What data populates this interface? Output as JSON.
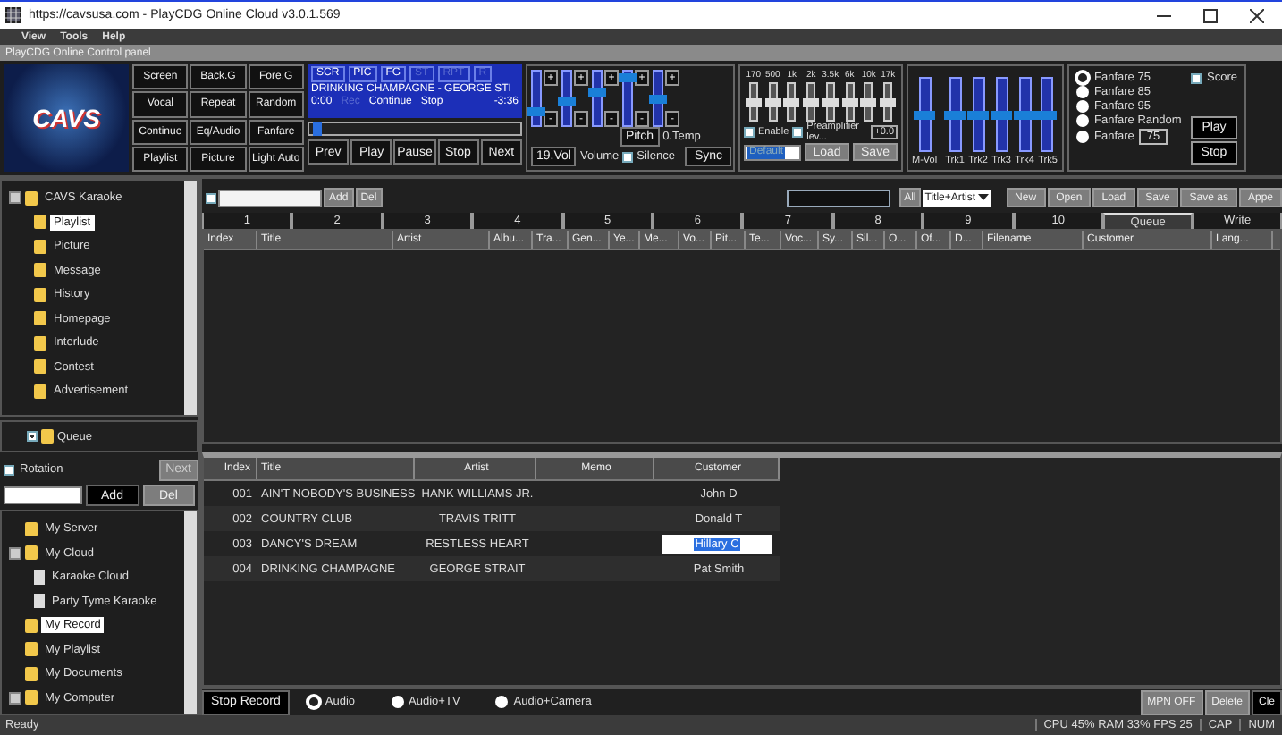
{
  "window": {
    "title": "https://cavsusa.com - PlayCDG Online Cloud v3.0.1.569"
  },
  "menu": [
    "View",
    "Tools",
    "Help"
  ],
  "panel_title": "PlayCDG Online Control panel",
  "logo": {
    "text": "CAVS"
  },
  "mode_buttons": [
    "Screen",
    "Back.G",
    "Fore.G",
    "Vocal",
    "Repeat",
    "Random",
    "Continue",
    "Eq/Audio",
    "Fanfare",
    "Playlist",
    "Picture",
    "Light Auto"
  ],
  "display": {
    "flags": [
      {
        "label": "SCR",
        "on": true
      },
      {
        "label": "PIC",
        "on": true
      },
      {
        "label": "FG",
        "on": true
      },
      {
        "label": "ST",
        "on": false
      },
      {
        "label": "RPT",
        "on": false
      },
      {
        "label": "R",
        "on": false
      }
    ],
    "song": "DRINKING CHAMPAGNE - GEORGE STI",
    "time": "0:00",
    "rec": {
      "text": "Rec",
      "on": false
    },
    "mode": "Continue",
    "state": "Stop",
    "remaining": "-3:36",
    "level": 0.02
  },
  "transport": [
    "Prev",
    "Play",
    "Pause",
    "Stop",
    "Next"
  ],
  "sliders": [
    {
      "level": 0.2,
      "up": "+",
      "down": "-"
    },
    {
      "level": 0.45,
      "up": "+",
      "down": "-"
    },
    {
      "level": 0.65,
      "up": "+",
      "down": "-"
    },
    {
      "level": 0.95,
      "up": "+",
      "down": "-"
    },
    {
      "level": 0.5,
      "up": "+",
      "down": "-"
    }
  ],
  "slider_labels": {
    "pitch": "Pitch",
    "tempo": "0.Temp",
    "vol": "19.Vol",
    "volume": "Volume",
    "silence": {
      "label": "Silence",
      "checked": false
    },
    "sync": "Sync"
  },
  "eq": {
    "bands": [
      {
        "label": "170",
        "level": 0.5
      },
      {
        "label": "500",
        "level": 0.5
      },
      {
        "label": "1k",
        "level": 0.5
      },
      {
        "label": "2k",
        "level": 0.5
      },
      {
        "label": "3.5k",
        "level": 0.5
      },
      {
        "label": "6k",
        "level": 0.5
      },
      {
        "label": "10k",
        "level": 0.5
      },
      {
        "label": "17k",
        "level": 0.5
      }
    ],
    "enable": {
      "label": "Enable",
      "checked": false
    },
    "preamp": {
      "label": "Preamplifier lev...",
      "checked": false
    },
    "gain": "+0.0",
    "preset": "Default",
    "load": "Load",
    "save": "Save"
  },
  "mixer": [
    {
      "label": "M-Vol",
      "level": 0.5
    },
    {
      "label": "Trk1",
      "level": 0.5
    },
    {
      "label": "Trk2",
      "level": 0.5
    },
    {
      "label": "Trk3",
      "level": 0.5
    },
    {
      "label": "Trk4",
      "level": 0.5
    },
    {
      "label": "Trk5",
      "level": 0.5
    }
  ],
  "fanfare": {
    "options": [
      {
        "label": "Fanfare 75",
        "selected": true
      },
      {
        "label": "Fanfare 85",
        "selected": false
      },
      {
        "label": "Fanfare 95",
        "selected": false
      },
      {
        "label": "Fanfare Random",
        "selected": false
      },
      {
        "label": "Fanfare",
        "selected": false,
        "value": "75"
      }
    ],
    "score": {
      "label": "Score",
      "checked": false
    },
    "play": "Play",
    "stop": "Stop"
  },
  "library_tree": [
    {
      "label": "CAVS Karaoke",
      "kind": "folder",
      "selected": false,
      "expanded": true,
      "children": [
        {
          "label": "Playlist",
          "kind": "folder",
          "selected": true
        },
        {
          "label": "Picture",
          "kind": "folder",
          "selected": false
        },
        {
          "label": "Message",
          "kind": "folder",
          "selected": false
        },
        {
          "label": "History",
          "kind": "folder",
          "selected": false
        },
        {
          "label": "Homepage",
          "kind": "folder",
          "selected": false
        },
        {
          "label": "Interlude",
          "kind": "folder",
          "selected": false
        },
        {
          "label": "Contest",
          "kind": "folder",
          "selected": false
        },
        {
          "label": "Advertisement",
          "kind": "folder",
          "selected": false
        }
      ]
    }
  ],
  "queue": {
    "label": "Queue",
    "checked": true
  },
  "rotation": {
    "label": "Rotation",
    "checked": false,
    "next": "Next"
  },
  "source_bar": {
    "add": "Add",
    "del": "Del"
  },
  "source_tree": [
    {
      "label": "My Server",
      "kind": "folder",
      "selected": false
    },
    {
      "label": "My Cloud",
      "kind": "folder",
      "selected": false,
      "expanded": true,
      "children": [
        {
          "label": "Karaoke Cloud",
          "kind": "file",
          "selected": false
        },
        {
          "label": "Party Tyme Karaoke",
          "kind": "file",
          "selected": false
        }
      ]
    },
    {
      "label": "My Record",
      "kind": "folder",
      "selected": true
    },
    {
      "label": "My Playlist",
      "kind": "folder",
      "selected": false
    },
    {
      "label": "My Documents",
      "kind": "folder",
      "selected": false
    },
    {
      "label": "My Computer",
      "kind": "folder",
      "selected": false,
      "expanded": true
    }
  ],
  "toolbar": {
    "select_all": false,
    "add": "Add",
    "del": "Del",
    "all": "All",
    "search_by": "Title+Artist",
    "buttons": [
      "New",
      "Open",
      "Load",
      "Save",
      "Save as",
      "Appe"
    ]
  },
  "tabs": [
    {
      "label": "1",
      "selected": false
    },
    {
      "label": "2",
      "selected": false
    },
    {
      "label": "3",
      "selected": false
    },
    {
      "label": "4",
      "selected": false
    },
    {
      "label": "5",
      "selected": false
    },
    {
      "label": "6",
      "selected": false
    },
    {
      "label": "7",
      "selected": false
    },
    {
      "label": "8",
      "selected": false
    },
    {
      "label": "9",
      "selected": false
    },
    {
      "label": "10",
      "selected": false
    },
    {
      "label": "Queue",
      "selected": true
    },
    {
      "label": "Write",
      "selected": false
    }
  ],
  "queue_table": {
    "columns": [
      "Index",
      "Title",
      "Artist",
      "Albu...",
      "Tra...",
      "Gen...",
      "Ye...",
      "Me...",
      "Vo...",
      "Pit...",
      "Te...",
      "Voc...",
      "Sy...",
      "Sil...",
      "O...",
      "Of...",
      "D...",
      "Filename",
      "Customer",
      "Lang..."
    ]
  },
  "record_table": {
    "columns": [
      "Index",
      "Title",
      "Artist",
      "Memo",
      "Customer"
    ],
    "rows": [
      {
        "index": "001",
        "title": "AIN'T NOBODY'S BUSINESS",
        "artist": "HANK WILLIAMS JR.",
        "customer": "John D",
        "editing": false
      },
      {
        "index": "002",
        "title": "COUNTRY CLUB",
        "artist": "TRAVIS TRITT",
        "customer": "Donald T",
        "editing": false
      },
      {
        "index": "003",
        "title": "DANCY'S DREAM",
        "artist": "RESTLESS HEART",
        "customer": "Hillary C",
        "editing": true
      },
      {
        "index": "004",
        "title": "DRINKING CHAMPAGNE",
        "artist": "GEORGE STRAIT",
        "customer": "Pat Smith",
        "editing": false
      }
    ]
  },
  "record_bar": {
    "stop_record": "Stop Record",
    "sources": [
      {
        "label": "Audio",
        "selected": true
      },
      {
        "label": "Audio+TV",
        "selected": false
      },
      {
        "label": "Audio+Camera",
        "selected": false
      }
    ],
    "buttons": [
      {
        "label": "MPN OFF",
        "kind": "grey"
      },
      {
        "label": "Delete",
        "kind": "grey"
      },
      {
        "label": "Cle",
        "kind": "dark"
      }
    ]
  },
  "status_bar": {
    "message": "Ready",
    "stats": "CPU 45% RAM 33% FPS 25",
    "caps": "CAP",
    "num": "NUM"
  }
}
